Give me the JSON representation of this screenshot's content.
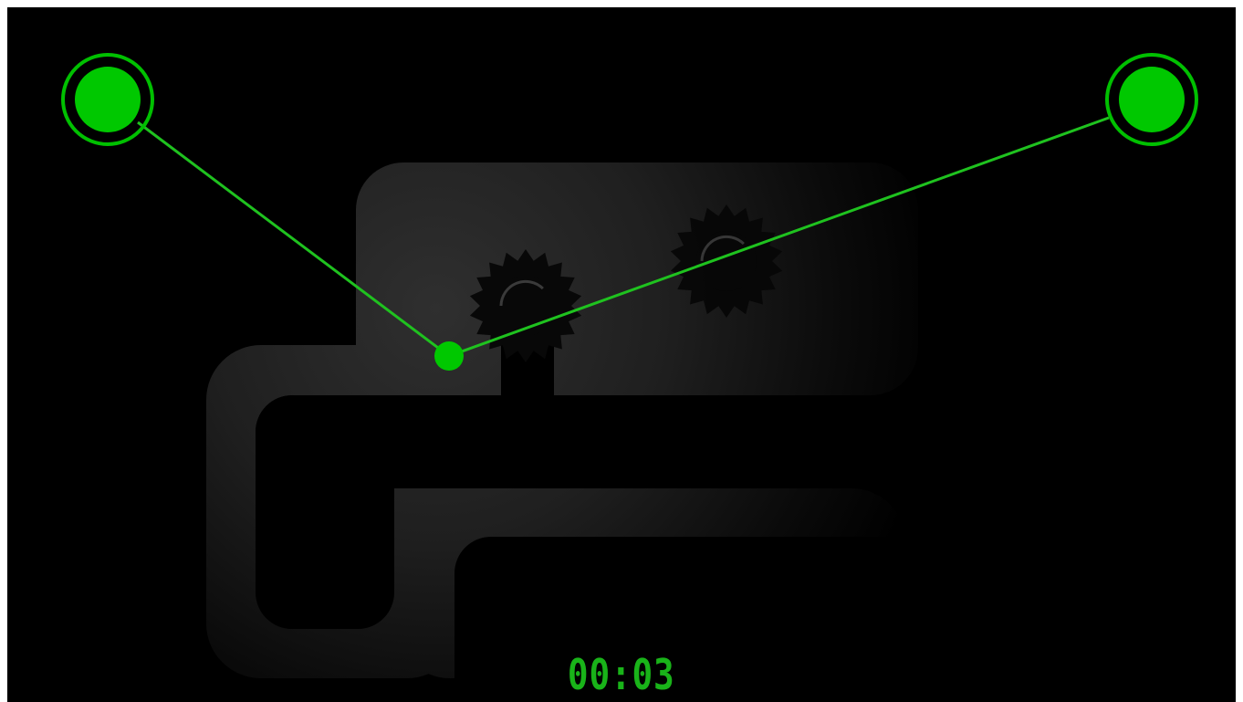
{
  "game": {
    "timer": "00:03"
  },
  "colors": {
    "background": "#000000",
    "track": "#2a2a2a",
    "gear": "#080808",
    "accent_green": "#00c800",
    "line_green": "#1fc21f",
    "timer_green": "#19b319"
  },
  "pieces": [
    {
      "name": "anchor-node-left",
      "role": "anchor"
    },
    {
      "name": "anchor-node-right",
      "role": "anchor"
    },
    {
      "name": "center-node",
      "role": "draggable"
    }
  ],
  "icons": [
    "gear-icon-left",
    "gear-icon-right"
  ]
}
